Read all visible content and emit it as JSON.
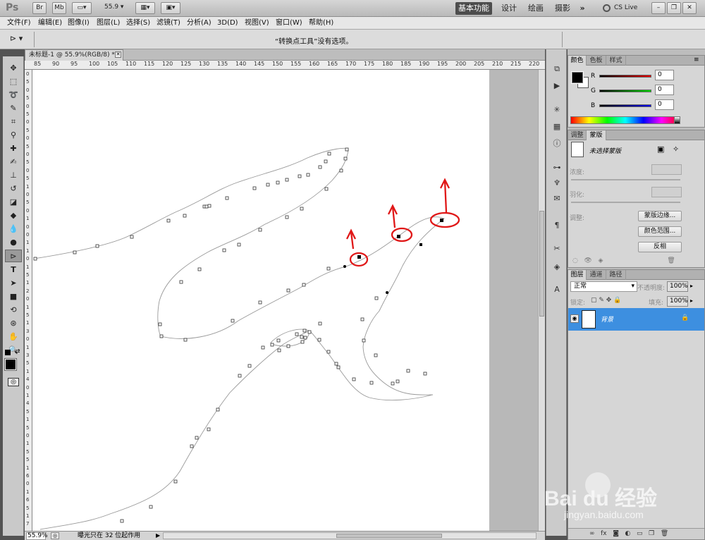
{
  "app": {
    "logo": "Ps",
    "zoom_value": "55.9"
  },
  "appbar": {
    "bridge_btn": "Br",
    "minibridge_btn": "Mb",
    "workspaces": {
      "essentials": "基本功能",
      "design": "设计",
      "painting": "绘画",
      "photography": "摄影",
      "more": "»"
    },
    "cslive": "CS Live"
  },
  "menu": [
    "文件(F)",
    "编辑(E)",
    "图像(I)",
    "图层(L)",
    "选择(S)",
    "滤镜(T)",
    "分析(A)",
    "3D(D)",
    "视图(V)",
    "窗口(W)",
    "帮助(H)"
  ],
  "options_bar": {
    "message": "“转换点工具”没有选项。"
  },
  "document": {
    "tab_title": "未标题-1 @ 55.9%(RGB/8) *",
    "ruler_h": [
      "85",
      "90",
      "95",
      "100",
      "105",
      "110",
      "115",
      "120",
      "125",
      "130",
      "135",
      "140",
      "145",
      "150",
      "155",
      "160",
      "165",
      "170",
      "175",
      "180",
      "185",
      "190",
      "195",
      "200",
      "205",
      "210",
      "215",
      "220"
    ],
    "ruler_v": [
      "0",
      "5",
      "0",
      "5",
      "0",
      "5",
      "0",
      "5",
      "0",
      "5",
      "0",
      "5",
      "0",
      "5",
      "1",
      "0",
      "5",
      "0",
      "1",
      "0",
      "0",
      "1",
      "1",
      "0",
      "1",
      "5",
      "1",
      "2",
      "0",
      "1",
      "5",
      "1",
      "3",
      "0",
      "1",
      "3",
      "5",
      "1",
      "4",
      "0",
      "1",
      "4",
      "5",
      "1",
      "5",
      "0",
      "1",
      "5",
      "5",
      "1",
      "6",
      "0",
      "1",
      "6",
      "5",
      "1",
      "7"
    ]
  },
  "statusbar": {
    "zoom": "55.9%",
    "message": "曝光只在 32 位起作用"
  },
  "color_panel": {
    "tabs": [
      "颜色",
      "色板",
      "样式"
    ],
    "channels": [
      {
        "label": "R",
        "value": "0"
      },
      {
        "label": "G",
        "value": "0"
      },
      {
        "label": "B",
        "value": "0"
      }
    ]
  },
  "masks_panel": {
    "tabs": [
      "调整",
      "蒙版"
    ],
    "title": "未选择蒙版",
    "density_label": "浓度:",
    "feather_label": "羽化:",
    "refine_label": "调整:",
    "buttons": [
      "蒙版边缘...",
      "颜色范围...",
      "反相"
    ]
  },
  "layers_panel": {
    "tabs": [
      "图层",
      "通道",
      "路径"
    ],
    "blend_mode": "正常",
    "opacity_label": "不透明度:",
    "opacity": "100%",
    "lock_label": "锁定:",
    "fill_label": "填充:",
    "fill": "100%",
    "layer_name": "背景"
  },
  "watermark": {
    "brand": "Bai du 经验",
    "url": "jingyan.baidu.com"
  },
  "colors": {
    "selection_blue": "#3d8fe0",
    "annotation_red": "#e01818"
  }
}
